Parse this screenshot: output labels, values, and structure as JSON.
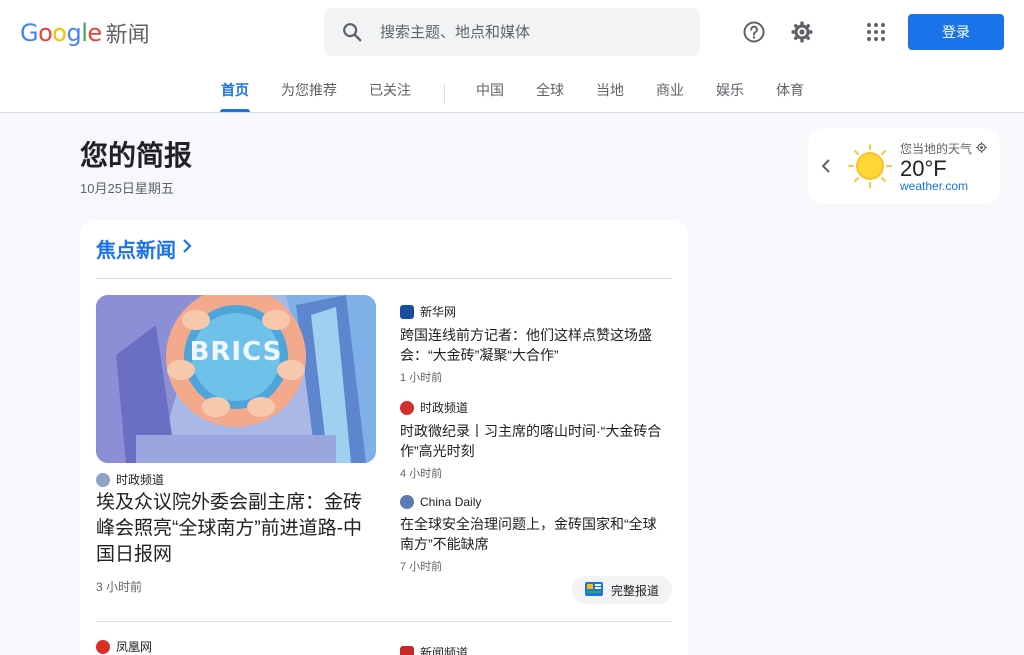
{
  "header": {
    "logo_brand": "Google",
    "logo_product": "新闻",
    "search_placeholder": "搜索主题、地点和媒体",
    "login_label": "登录",
    "icons": [
      "search-icon",
      "help-icon",
      "settings-icon",
      "apps-icon"
    ]
  },
  "nav": {
    "tabs": [
      {
        "label": "首页",
        "active": true
      },
      {
        "label": "为您推荐",
        "active": false
      },
      {
        "label": "已关注",
        "active": false
      },
      {
        "label": "中国",
        "active": false
      },
      {
        "label": "全球",
        "active": false
      },
      {
        "label": "当地",
        "active": false
      },
      {
        "label": "商业",
        "active": false
      },
      {
        "label": "娱乐",
        "active": false
      },
      {
        "label": "体育",
        "active": false
      }
    ]
  },
  "briefing": {
    "title": "您的简报",
    "date": "10月25日星期五"
  },
  "weather": {
    "label": "您当地的天气",
    "temperature": "20°F",
    "source": "weather.com"
  },
  "top_stories": {
    "heading": "焦点新闻",
    "hero": {
      "image_text": "BRICS",
      "source": "时政频道",
      "title": "埃及众议院外委会副主席：金砖峰会照亮“全球南方”前进道路-中国日报网",
      "time": "3 小时前"
    },
    "articles": [
      {
        "source": "新华网",
        "title": "跨国连线前方记者：他们这样点赞这场盛会：“大金砖”凝聚“大合作”",
        "time": "1 小时前"
      },
      {
        "source": "时政频道",
        "title": "时政微纪录丨习主席的喀山时间·“大金砖合作”高光时刻",
        "time": "4 小时前"
      },
      {
        "source": "China Daily",
        "title": "在全球安全治理问题上，金砖国家和“全球南方”不能缺席",
        "time": "7 小时前"
      }
    ],
    "full_coverage_label": "完整报道",
    "next_sources": [
      "凤凰网",
      "新闻频道"
    ]
  },
  "colors": {
    "accent": "#1a73e8",
    "background": "#f6f8fc",
    "card": "#ffffff"
  }
}
